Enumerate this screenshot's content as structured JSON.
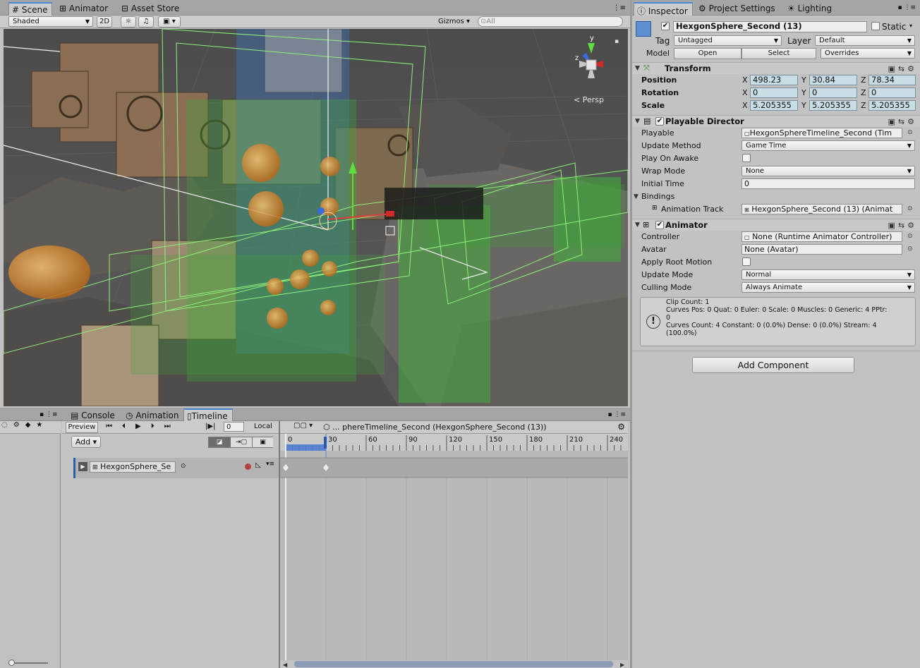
{
  "scene_tabs": [
    {
      "label": "Scene"
    },
    {
      "label": "Animator"
    },
    {
      "label": "Asset Store"
    }
  ],
  "scene_toolbar": {
    "shading": "Shaded",
    "mode_2d": "2D",
    "gizmos": "Gizmos",
    "search_placeholder": "All"
  },
  "scene_view": {
    "gizmo_y": "y",
    "gizmo_z": "z",
    "projection": "Persp"
  },
  "bottom_tabs": [
    {
      "label": "Console"
    },
    {
      "label": "Animation"
    },
    {
      "label": "Timeline"
    }
  ],
  "timeline": {
    "preview": "Preview",
    "frame": "0",
    "local": "Local",
    "breadcrumb": "... phereTimeline_Second (HexgonSphere_Second (13))",
    "add_label": "Add",
    "ruler_ticks": [
      "0",
      "30",
      "60",
      "90",
      "120",
      "150",
      "180",
      "210",
      "240"
    ],
    "track_name": "HexgonSphere_Se"
  },
  "inspector_tabs": [
    {
      "label": "Inspector"
    },
    {
      "label": "Project Settings"
    },
    {
      "label": "Lighting"
    }
  ],
  "inspector": {
    "object_name": "HexgonSphere_Second (13)",
    "static_label": "Static",
    "tag_label": "Tag",
    "tag_value": "Untagged",
    "layer_label": "Layer",
    "layer_value": "Default",
    "model_label": "Model",
    "open_button": "Open",
    "select_button": "Select",
    "overrides": "Overrides"
  },
  "transform": {
    "title": "Transform",
    "position_label": "Position",
    "position": {
      "x": "498.23",
      "y": "30.84",
      "z": "78.34"
    },
    "rotation_label": "Rotation",
    "rotation": {
      "x": "0",
      "y": "0",
      "z": "0"
    },
    "scale_label": "Scale",
    "scale": {
      "x": "5.205355",
      "y": "5.205355",
      "z": "5.205355"
    },
    "axis_x": "X",
    "axis_y": "Y",
    "axis_z": "Z"
  },
  "playable_director": {
    "title": "Playable Director",
    "playable_label": "Playable",
    "playable_value": "HexgonSphereTimeline_Second (Tim",
    "update_method_label": "Update Method",
    "update_method_value": "Game Time",
    "play_on_awake_label": "Play On Awake",
    "wrap_mode_label": "Wrap Mode",
    "wrap_mode_value": "None",
    "initial_time_label": "Initial Time",
    "initial_time_value": "0",
    "bindings_label": "Bindings",
    "animation_track_label": "Animation Track",
    "animation_track_value": "HexgonSphere_Second (13) (Animat"
  },
  "animator": {
    "title": "Animator",
    "controller_label": "Controller",
    "controller_value": "None (Runtime Animator Controller)",
    "avatar_label": "Avatar",
    "avatar_value": "None (Avatar)",
    "apply_root_motion_label": "Apply Root Motion",
    "update_mode_label": "Update Mode",
    "update_mode_value": "Normal",
    "culling_mode_label": "Culling Mode",
    "culling_mode_value": "Always Animate",
    "info_line1": "Clip Count: 1",
    "info_line2": "Curves Pos: 0 Quat: 0 Euler: 0 Scale: 0 Muscles: 0 Generic: 4 PPtr:",
    "info_line3": "0",
    "info_line4": "Curves Count: 4 Constant: 0 (0.0%) Dense: 0 (0.0%) Stream: 4",
    "info_line5": "(100.0%)"
  },
  "add_component": "Add Component"
}
